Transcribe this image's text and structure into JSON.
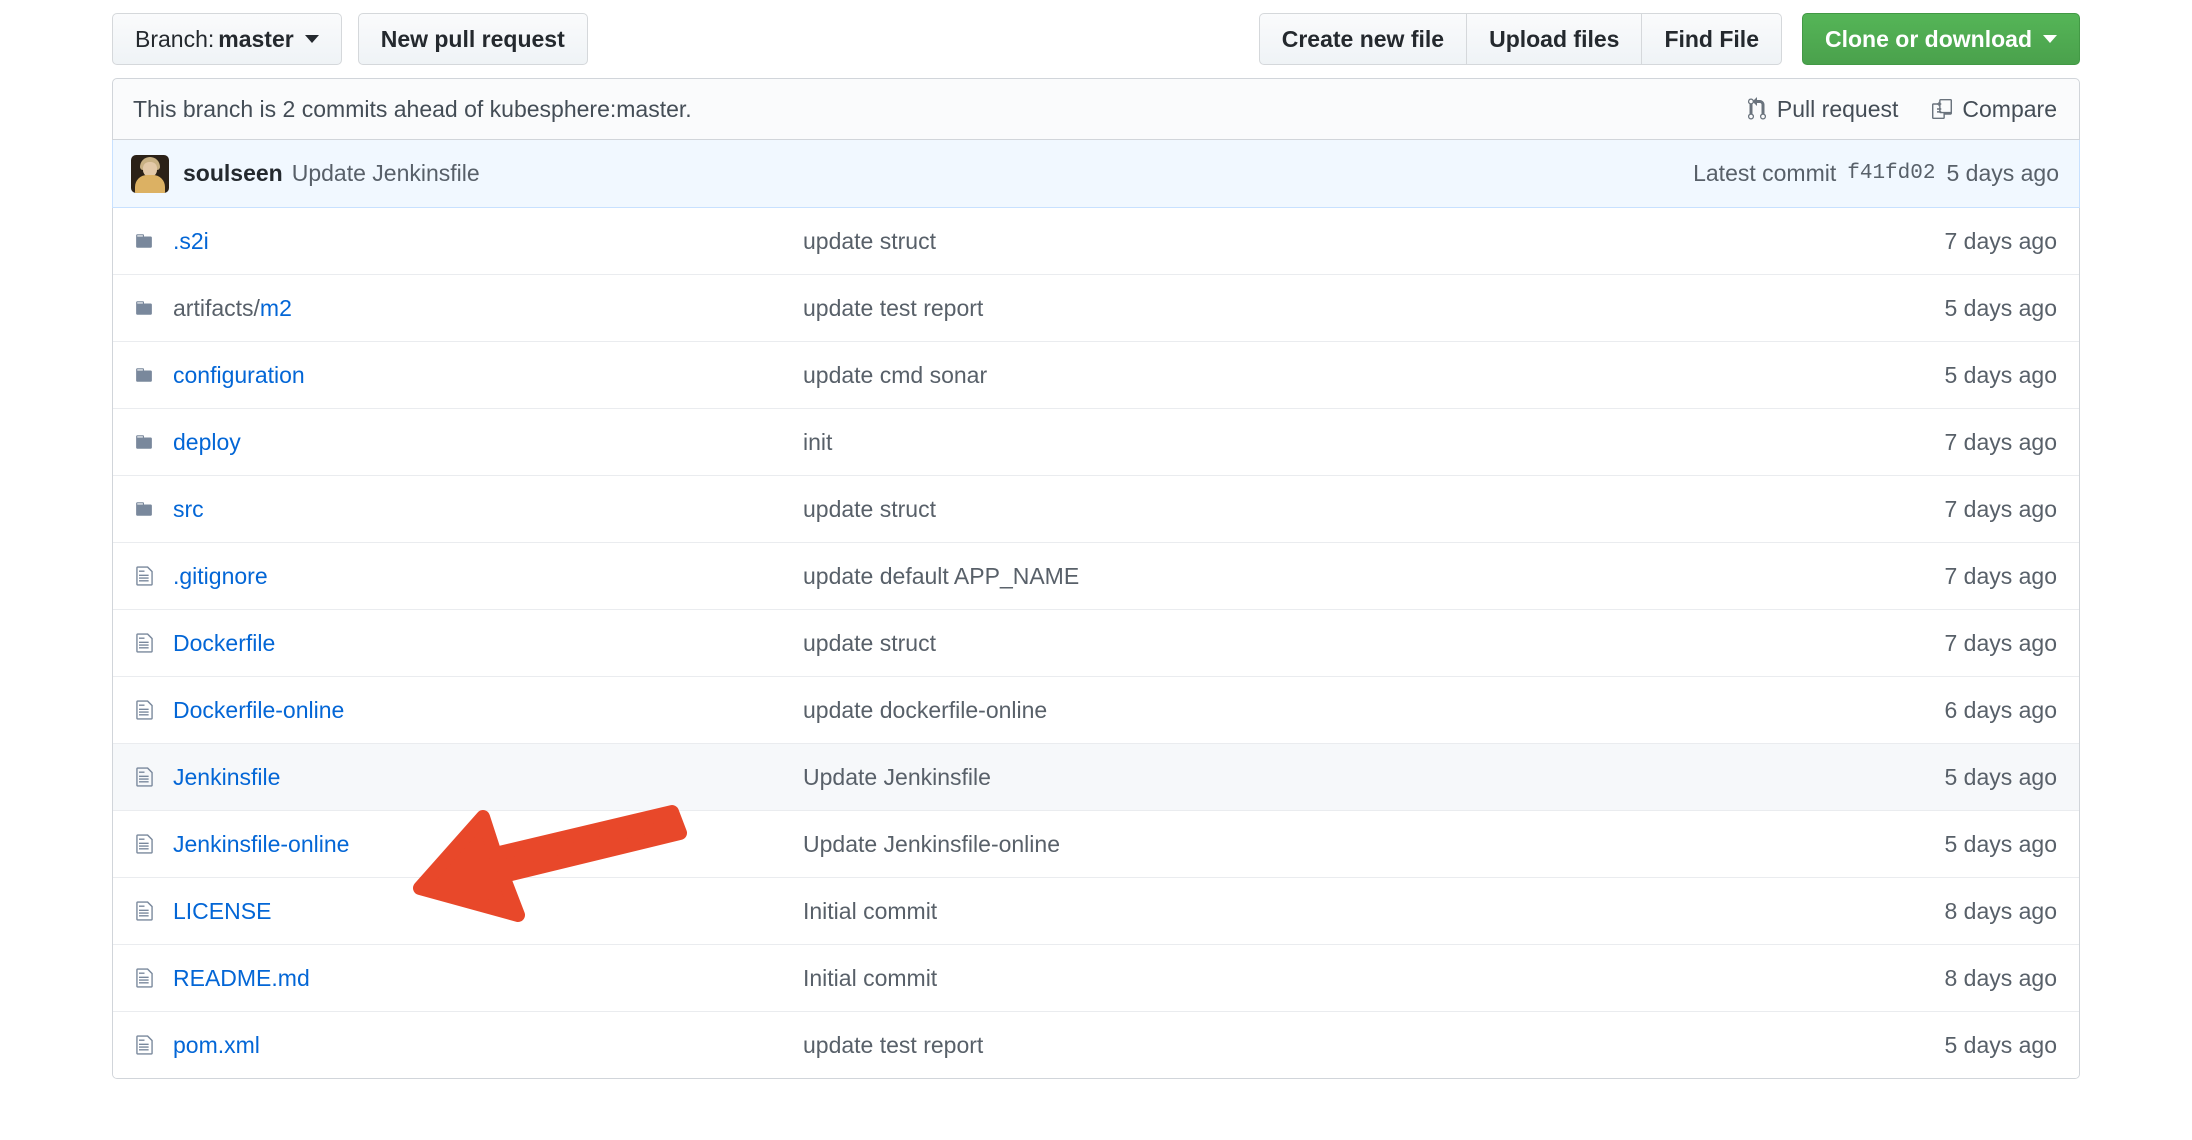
{
  "toolbar": {
    "branch_prefix": "Branch:",
    "branch_name": "master",
    "new_pull_request": "New pull request",
    "create_new_file": "Create new file",
    "upload_files": "Upload files",
    "find_file": "Find File",
    "clone_or_download": "Clone or download"
  },
  "notice": {
    "text": "This branch is 2 commits ahead of kubesphere:master.",
    "pull_request": "Pull request",
    "compare": "Compare"
  },
  "commit": {
    "author": "soulseen",
    "message": "Update Jenkinsfile",
    "latest_label": "Latest commit",
    "sha": "f41fd02",
    "age": "5 days ago"
  },
  "files": [
    {
      "type": "folder",
      "name": ".s2i",
      "prefix": "",
      "message": "update struct",
      "age": "7 days ago",
      "highlight": false
    },
    {
      "type": "folder",
      "name": "m2",
      "prefix": "artifacts/",
      "message": "update test report",
      "age": "5 days ago",
      "highlight": false
    },
    {
      "type": "folder",
      "name": "configuration",
      "prefix": "",
      "message": "update cmd sonar",
      "age": "5 days ago",
      "highlight": false
    },
    {
      "type": "folder",
      "name": "deploy",
      "prefix": "",
      "message": "init",
      "age": "7 days ago",
      "highlight": false
    },
    {
      "type": "folder",
      "name": "src",
      "prefix": "",
      "message": "update struct",
      "age": "7 days ago",
      "highlight": false
    },
    {
      "type": "file",
      "name": ".gitignore",
      "prefix": "",
      "message": "update default APP_NAME",
      "age": "7 days ago",
      "highlight": false
    },
    {
      "type": "file",
      "name": "Dockerfile",
      "prefix": "",
      "message": "update struct",
      "age": "7 days ago",
      "highlight": false
    },
    {
      "type": "file",
      "name": "Dockerfile-online",
      "prefix": "",
      "message": "update dockerfile-online",
      "age": "6 days ago",
      "highlight": false
    },
    {
      "type": "file",
      "name": "Jenkinsfile",
      "prefix": "",
      "message": "Update Jenkinsfile",
      "age": "5 days ago",
      "highlight": true
    },
    {
      "type": "file",
      "name": "Jenkinsfile-online",
      "prefix": "",
      "message": "Update Jenkinsfile-online",
      "age": "5 days ago",
      "highlight": false
    },
    {
      "type": "file",
      "name": "LICENSE",
      "prefix": "",
      "message": "Initial commit",
      "age": "8 days ago",
      "highlight": false
    },
    {
      "type": "file",
      "name": "README.md",
      "prefix": "",
      "message": "Initial commit",
      "age": "8 days ago",
      "highlight": false
    },
    {
      "type": "file",
      "name": "pom.xml",
      "prefix": "",
      "message": "update test report",
      "age": "5 days ago",
      "highlight": false
    }
  ],
  "annotation": {
    "kind": "arrow-pointer",
    "points_at": "Jenkinsfile-online",
    "color": "#e8482a"
  },
  "icons": {
    "folder": "folder-icon",
    "file": "file-icon",
    "pull_request": "git-pull-request-icon",
    "compare": "diff-compare-icon",
    "caret": "chevron-down-icon"
  },
  "colors": {
    "link": "#0366d6",
    "muted": "#586069",
    "green_button": "#55b557",
    "notice_bg": "#fafbfc",
    "commit_bg": "#f1f8ff",
    "commit_border": "#c8e1ff",
    "row_highlight": "#f6f8fa",
    "arrow": "#e8482a"
  }
}
